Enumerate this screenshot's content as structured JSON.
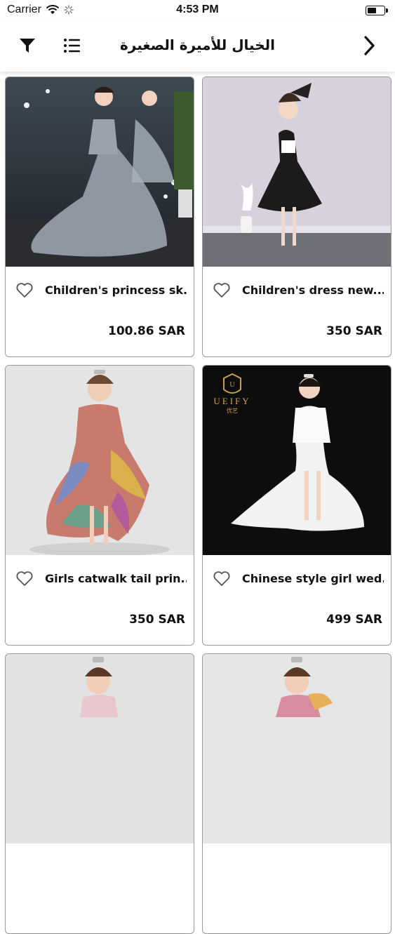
{
  "status_bar": {
    "carrier": "Carrier",
    "time": "4:53 PM"
  },
  "nav": {
    "title": "الخيال للأميرة الصغيرة"
  },
  "products": [
    {
      "name": "Children's princess sk...",
      "price": "100.86 SAR"
    },
    {
      "name": "Children's dress new...",
      "price": "350 SAR"
    },
    {
      "name": "Girls catwalk tail prin...",
      "price": "350 SAR"
    },
    {
      "name": "Chinese style girl wed...",
      "price": "499 SAR"
    }
  ],
  "photo_watermark": {
    "brand": "UEIFY",
    "sub": "优艺"
  }
}
